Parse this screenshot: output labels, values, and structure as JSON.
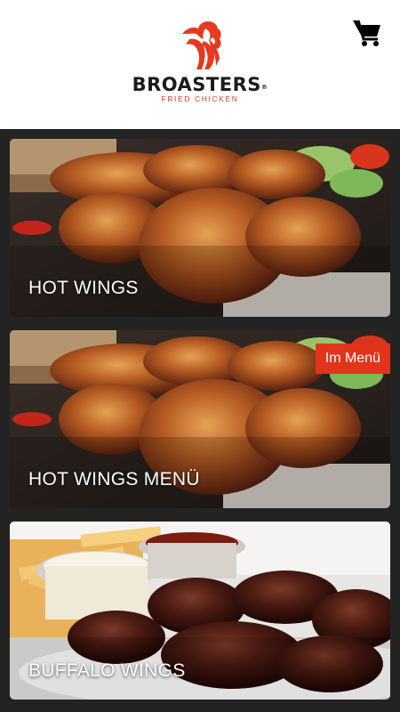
{
  "header": {
    "brand_name": "BROASTERS",
    "brand_mark": "®",
    "tagline": "FRIED CHICKEN",
    "logo_icon": "rooster-comb-logo-icon",
    "cart_icon": "shopping-cart-icon"
  },
  "menu": {
    "items": [
      {
        "title": "HOT WINGS"
      },
      {
        "title": "HOT WINGS MENÜ",
        "badge": "Im Menü"
      },
      {
        "title": "BUFFALO WINGS"
      }
    ]
  },
  "colors": {
    "accent": "#e2341b",
    "page_background": "#232323",
    "header_background": "#ffffff"
  }
}
